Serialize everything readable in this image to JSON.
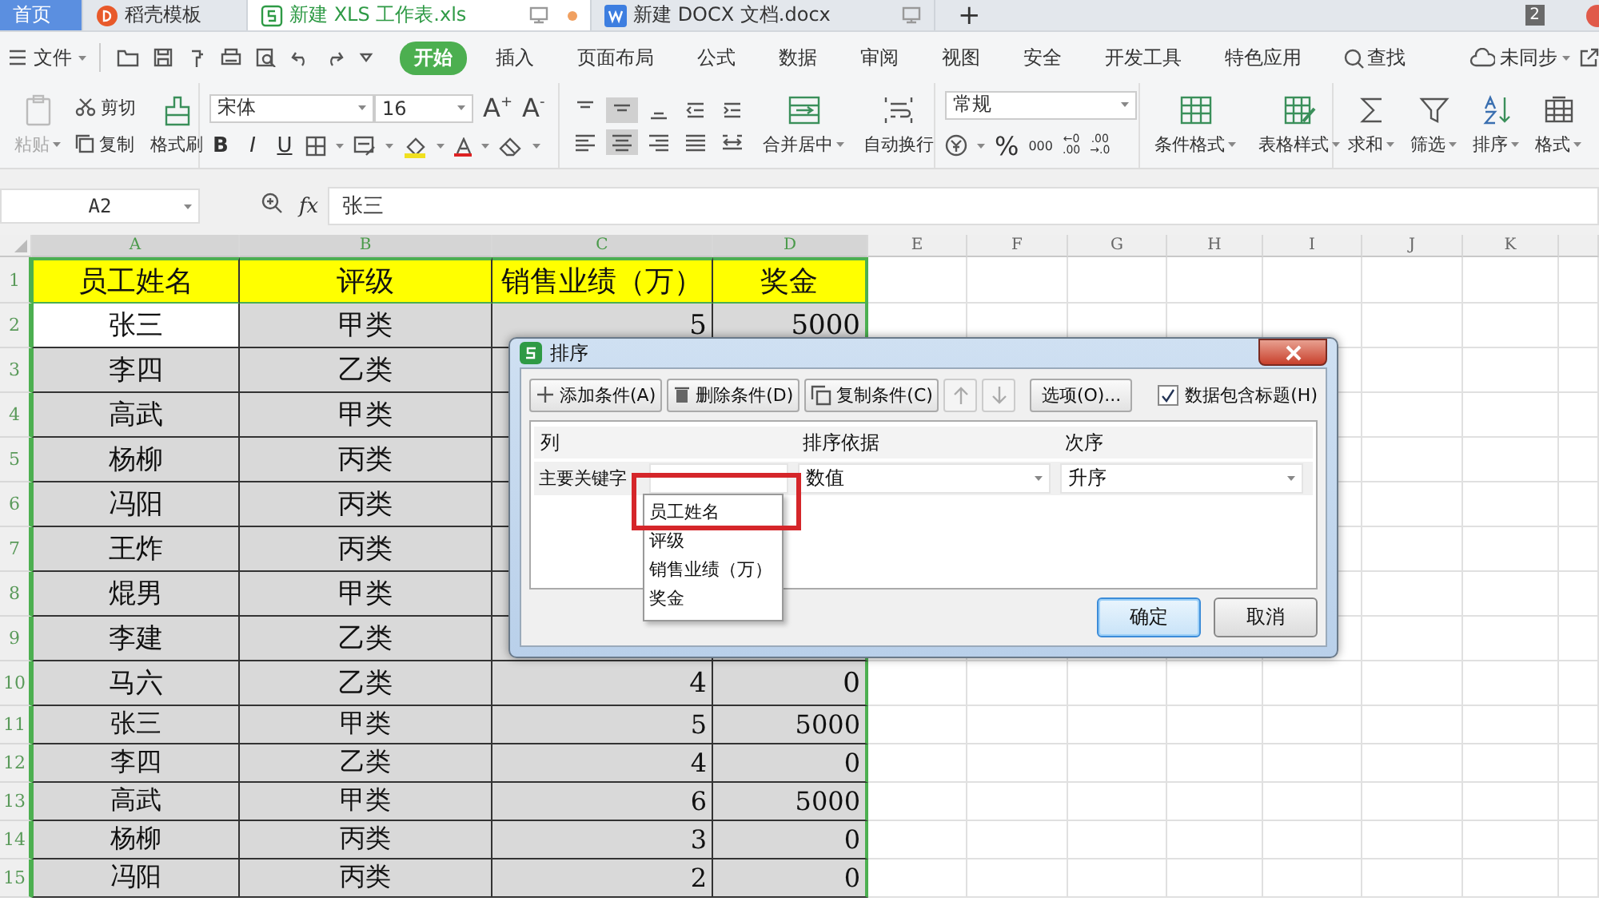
{
  "tabs": [
    {
      "label": "首页",
      "kind": "home",
      "selected": false,
      "unsaved": false
    },
    {
      "label": "稻壳模板",
      "kind": "docer",
      "selected": false,
      "unsaved": false
    },
    {
      "label": "新建 XLS 工作表.xls",
      "kind": "sheet",
      "selected": true,
      "unsaved": true
    },
    {
      "label": "新建 DOCX 文档.docx",
      "kind": "doc",
      "selected": false,
      "unsaved": false
    }
  ],
  "new_tab": "+",
  "window_count": "2",
  "menu": {
    "file": "文件",
    "tabs": [
      {
        "label": "开始",
        "selected": true
      },
      {
        "label": "插入",
        "selected": false
      },
      {
        "label": "页面布局",
        "selected": false
      },
      {
        "label": "公式",
        "selected": false
      },
      {
        "label": "数据",
        "selected": false
      },
      {
        "label": "审阅",
        "selected": false
      },
      {
        "label": "视图",
        "selected": false
      },
      {
        "label": "安全",
        "selected": false
      },
      {
        "label": "开发工具",
        "selected": false
      },
      {
        "label": "特色应用",
        "selected": false
      }
    ],
    "search": "查找",
    "sync": "未同步"
  },
  "ribbon": {
    "paste": "粘贴",
    "cut": "剪切",
    "copy": "复制",
    "format_painter": "格式刷",
    "font_name": "宋体",
    "font_size": "16",
    "grow_font": "A$^{+}$",
    "shrink_font": "A$^{-}$",
    "style_buttons": [
      "B",
      "I",
      "U"
    ],
    "merge": "合并居中",
    "wrap": "自动换行",
    "number_format": "常规",
    "percent": "%",
    "thousands": "000",
    "inc_decimal": [
      "←0",
      ".00"
    ],
    "dec_decimal": [
      ".00",
      "→.0"
    ],
    "big_buttons": [
      {
        "label": "条件格式",
        "kind": "conditional"
      },
      {
        "label": "表格样式",
        "kind": "table_style"
      },
      {
        "label": "求和",
        "kind": "sum"
      },
      {
        "label": "筛选",
        "kind": "filter"
      },
      {
        "label": "排序",
        "kind": "sort"
      },
      {
        "label": "格式",
        "kind": "format"
      }
    ]
  },
  "formula_bar": {
    "cell_ref": "A2",
    "fx": "fx",
    "value": "张三"
  },
  "sheet": {
    "columns": [
      {
        "label": "A",
        "selected": true
      },
      {
        "label": "B",
        "selected": true
      },
      {
        "label": "C",
        "selected": true
      },
      {
        "label": "D",
        "selected": true
      },
      {
        "label": "E",
        "selected": false
      },
      {
        "label": "F",
        "selected": false
      },
      {
        "label": "G",
        "selected": false
      },
      {
        "label": "H",
        "selected": false
      },
      {
        "label": "I",
        "selected": false
      },
      {
        "label": "J",
        "selected": false
      },
      {
        "label": "K",
        "selected": false
      }
    ],
    "rows": [
      {
        "number": "1",
        "kind": "header",
        "selected": true,
        "cells": [
          {
            "text": "员工姓名",
            "active": false
          },
          {
            "text": "评级",
            "active": false
          },
          {
            "text": "销售业绩（万）",
            "active": false
          },
          {
            "text": "奖金",
            "active": false
          }
        ]
      },
      {
        "number": "2",
        "kind": "data",
        "selected": true,
        "cells": [
          {
            "text": "张三",
            "active": true
          },
          {
            "text": "甲类",
            "active": false
          },
          {
            "text": "5",
            "active": false
          },
          {
            "text": "5000",
            "active": false
          }
        ]
      },
      {
        "number": "3",
        "kind": "data",
        "selected": true,
        "cells": [
          {
            "text": "李四",
            "active": false
          },
          {
            "text": "乙类",
            "active": false
          }
        ]
      },
      {
        "number": "4",
        "kind": "data",
        "selected": true,
        "cells": [
          {
            "text": "高武",
            "active": false
          },
          {
            "text": "甲类",
            "active": false
          }
        ]
      },
      {
        "number": "5",
        "kind": "data",
        "selected": true,
        "cells": [
          {
            "text": "杨柳",
            "active": false
          },
          {
            "text": "丙类",
            "active": false
          }
        ]
      },
      {
        "number": "6",
        "kind": "data",
        "selected": true,
        "cells": [
          {
            "text": "冯阳",
            "active": false
          },
          {
            "text": "丙类",
            "active": false
          }
        ]
      },
      {
        "number": "7",
        "kind": "data",
        "selected": true,
        "cells": [
          {
            "text": "王炸",
            "active": false
          },
          {
            "text": "丙类",
            "active": false
          }
        ]
      },
      {
        "number": "8",
        "kind": "data",
        "selected": true,
        "cells": [
          {
            "text": "焜男",
            "active": false
          },
          {
            "text": "甲类",
            "active": false
          }
        ]
      },
      {
        "number": "9",
        "kind": "data",
        "selected": true,
        "cells": [
          {
            "text": "李建",
            "active": false
          },
          {
            "text": "乙类",
            "active": false
          }
        ]
      },
      {
        "number": "10",
        "kind": "data",
        "selected": true,
        "cells": [
          {
            "text": "马六",
            "active": false
          },
          {
            "text": "乙类",
            "active": false
          },
          {
            "text": "4",
            "active": false
          },
          {
            "text": "0",
            "active": false
          }
        ]
      },
      {
        "number": "11",
        "kind": "data",
        "selected": true,
        "cells": [
          {
            "text": "张三",
            "active": false
          },
          {
            "text": "甲类",
            "active": false
          },
          {
            "text": "5",
            "active": false
          },
          {
            "text": "5000",
            "active": false
          }
        ]
      },
      {
        "number": "12",
        "kind": "data",
        "selected": true,
        "cells": [
          {
            "text": "李四",
            "active": false
          },
          {
            "text": "乙类",
            "active": false
          },
          {
            "text": "4",
            "active": false
          },
          {
            "text": "0",
            "active": false
          }
        ]
      },
      {
        "number": "13",
        "kind": "data",
        "selected": true,
        "cells": [
          {
            "text": "高武",
            "active": false
          },
          {
            "text": "甲类",
            "active": false
          },
          {
            "text": "6",
            "active": false
          },
          {
            "text": "5000",
            "active": false
          }
        ]
      },
      {
        "number": "14",
        "kind": "data",
        "selected": true,
        "cells": [
          {
            "text": "杨柳",
            "active": false
          },
          {
            "text": "丙类",
            "active": false
          },
          {
            "text": "3",
            "active": false
          },
          {
            "text": "0",
            "active": false
          }
        ]
      },
      {
        "number": "15",
        "kind": "data",
        "selected": true,
        "cells": [
          {
            "text": "冯阳",
            "active": false
          },
          {
            "text": "丙类",
            "active": false
          },
          {
            "text": "2",
            "active": false
          },
          {
            "text": "0",
            "active": false
          }
        ]
      }
    ]
  },
  "sort_dialog": {
    "title": "排序",
    "toolbar": [
      {
        "label": "添加条件(A)",
        "kind": "add",
        "disabled": false
      },
      {
        "label": "删除条件(D)",
        "kind": "delete",
        "disabled": false
      },
      {
        "label": "复制条件(C)",
        "kind": "copy",
        "disabled": false
      },
      {
        "kind": "up",
        "disabled": true
      },
      {
        "kind": "down",
        "disabled": true
      },
      {
        "label": "选项(O)...",
        "kind": "options",
        "disabled": false
      }
    ],
    "has_header": {
      "label": "数据包含标题(H)",
      "checked": true
    },
    "columns": [
      "列",
      "排序依据",
      "次序"
    ],
    "rule": {
      "label": "主要关键字",
      "basis": "数值",
      "order": "升序"
    },
    "dropdown": [
      {
        "label": "员工姓名",
        "highlighted": true
      },
      {
        "label": "评级",
        "highlighted": false
      },
      {
        "label": "销售业绩（万）",
        "highlighted": false
      },
      {
        "label": "奖金",
        "highlighted": false
      }
    ],
    "buttons": [
      {
        "label": "确定",
        "kind": "primary"
      },
      {
        "label": "取消",
        "kind": "secondary"
      }
    ]
  }
}
